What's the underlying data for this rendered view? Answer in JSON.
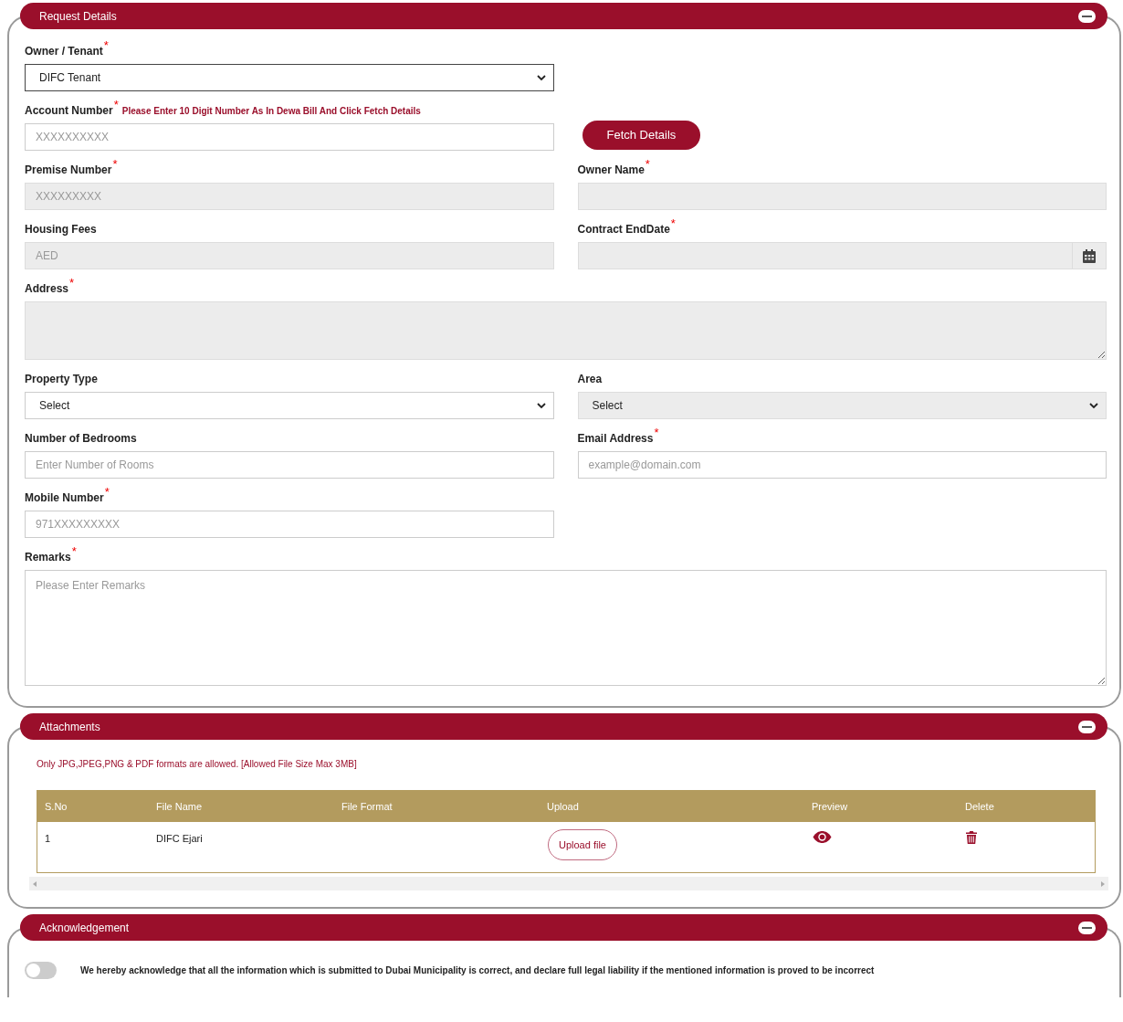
{
  "sections": [
    {
      "kind": "form",
      "title": "Request Details",
      "expanded": true,
      "rows": [
        [
          {
            "kind": "select",
            "label": "Owner / Tenant",
            "required_mark": "*",
            "value": "DIFC Tenant",
            "disabled": false
          }
        ],
        [
          {
            "kind": "input",
            "label": "Account Number",
            "required_mark": "*",
            "hint": "Please Enter 10 Digit Number As In Dewa Bill And Click Fetch Details",
            "placeholder": "XXXXXXXXXX",
            "disabled": false
          },
          {
            "kind": "button",
            "label": "Fetch Details"
          }
        ],
        [
          {
            "kind": "input",
            "label": "Premise Number",
            "required_mark": "*",
            "placeholder": "XXXXXXXXX",
            "disabled": true
          },
          {
            "kind": "input",
            "label": "Owner Name",
            "required_mark": "*",
            "disabled": true
          }
        ],
        [
          {
            "kind": "input",
            "label": "Housing Fees",
            "placeholder": "AED",
            "disabled": true
          },
          {
            "kind": "date",
            "label": "Contract EndDate",
            "required_mark": "*",
            "disabled": true
          }
        ],
        [
          {
            "kind": "textarea",
            "label": "Address",
            "required_mark": "*",
            "disabled": true
          }
        ],
        [
          {
            "kind": "select",
            "label": "Property Type",
            "value": "Select",
            "disabled": false
          },
          {
            "kind": "select",
            "label": "Area",
            "value": "Select",
            "disabled": true
          }
        ],
        [
          {
            "kind": "input",
            "label": "Number of Bedrooms",
            "placeholder": "Enter Number of Rooms",
            "disabled": false
          },
          {
            "kind": "input",
            "label": "Email Address",
            "required_mark": "*",
            "placeholder": "example@domain.com",
            "disabled": false
          }
        ],
        [
          {
            "kind": "input",
            "label": "Mobile Number",
            "required_mark": "*",
            "placeholder": "971XXXXXXXXX",
            "disabled": false
          }
        ],
        [
          {
            "kind": "memo",
            "label": "Remarks",
            "required_mark": "*",
            "placeholder": "Please Enter Remarks",
            "disabled": false
          }
        ]
      ]
    },
    {
      "kind": "attachments",
      "title": "Attachments",
      "expanded": true,
      "note": "Only JPG,JPEG,PNG & PDF formats are allowed. [Allowed File Size Max 3MB]",
      "columns": [
        "S.No",
        "File Name",
        "File Format",
        "Upload",
        "Preview",
        "Delete"
      ],
      "rows": [
        {
          "sno": "1",
          "file_name": "DIFC Ejari",
          "upload": "Upload file"
        }
      ]
    },
    {
      "kind": "acknowledgement",
      "title": "Acknowledgement",
      "expanded": true,
      "on": false,
      "text": "We hereby acknowledge that all the information which is submitted to Dubai Municipality is correct, and declare full legal liability if the mentioned information is proved to be incorrect"
    }
  ]
}
